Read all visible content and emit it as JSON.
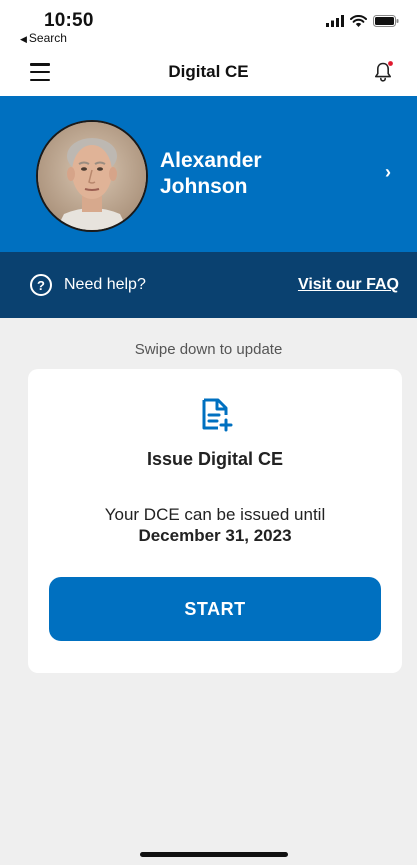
{
  "status_bar": {
    "time": "10:50",
    "back_label": "Search"
  },
  "nav": {
    "title": "Digital CE",
    "menu_icon": "hamburger-menu-icon",
    "bell_icon": "bell-icon",
    "bell_badge_color": "#e0182d"
  },
  "profile": {
    "first_name": "Alexander",
    "last_name": "Johnson"
  },
  "help": {
    "text": "Need help?",
    "faq_link": "Visit our FAQ"
  },
  "main": {
    "swipe_hint": "Swipe down to update",
    "card": {
      "icon": "document-add-icon",
      "title": "Issue Digital CE",
      "description": "Your DCE can be issued until",
      "date": "December 31, 2023",
      "start_label": "START"
    }
  },
  "colors": {
    "primary_blue": "#0070c0",
    "dark_blue": "#0a4170",
    "background": "#efefef"
  }
}
